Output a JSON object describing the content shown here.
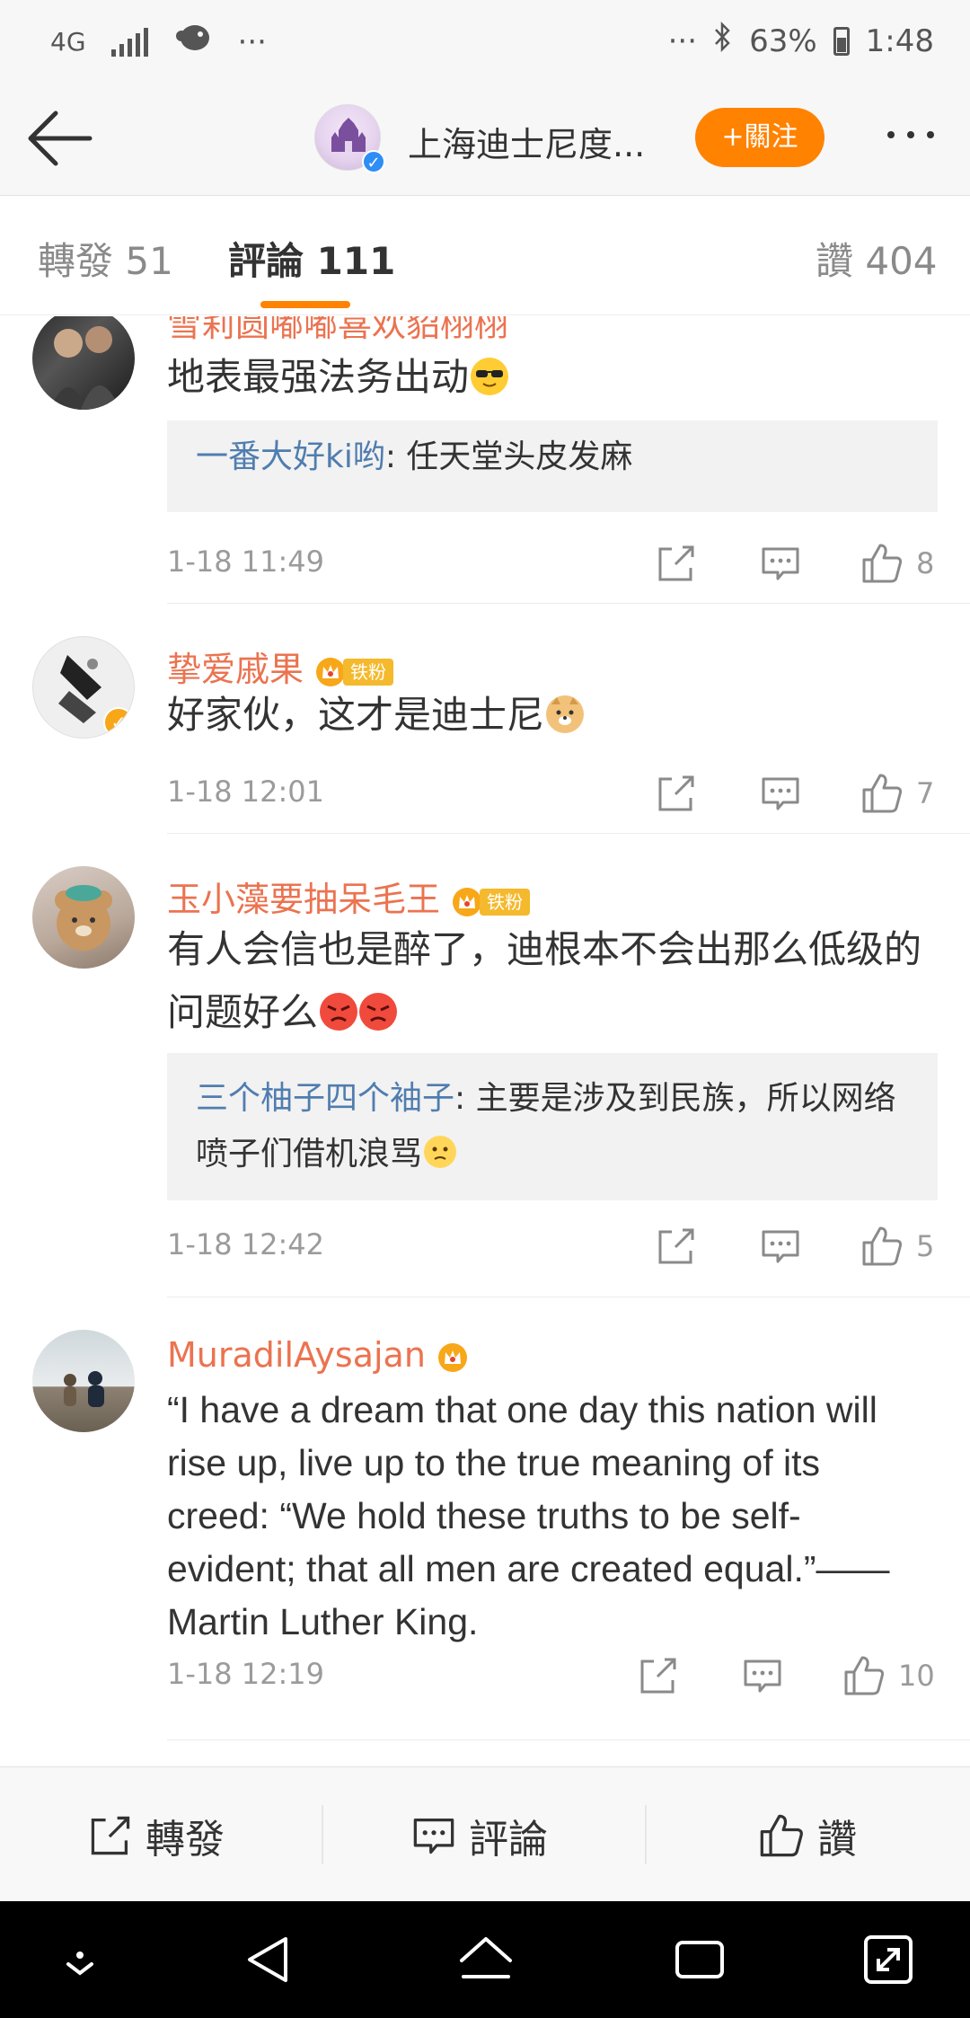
{
  "status_bar": {
    "network": "4G",
    "left_dots": "···",
    "right_dots": "···",
    "battery": "63%",
    "time": "1:48"
  },
  "header": {
    "account_name": "上海迪士尼度...",
    "follow_label": "+關注"
  },
  "tabs": {
    "repost": "轉發 51",
    "comments": "評論 111",
    "likes": "讚 404"
  },
  "comments": [
    {
      "username": "雪莉圆嘟嘟喜欢貂栩栩",
      "text": "地表最强法务出动",
      "emoji": "sunglasses",
      "reply": {
        "user": "一番大好ki哟",
        "text": ": 任天堂头皮发麻"
      },
      "time": "1-18 11:49",
      "likes": "8"
    },
    {
      "username": "挚爱戚果",
      "fan_badge": "铁粉",
      "text": "好家伙，这才是迪士尼",
      "emoji": "doge",
      "time": "1-18 12:01",
      "likes": "7"
    },
    {
      "username": "玉小藻要抽呆毛王",
      "fan_badge": "铁粉",
      "text": "有人会信也是醉了，迪根本不会出那么低级的问题好么",
      "emoji": "angry",
      "reply": {
        "user": "三个柚子四个袖子",
        "text": ": 主要是涉及到民族，所以网络喷子们借机浪骂"
      },
      "time": "1-18 12:42",
      "likes": "5"
    },
    {
      "username": "MuradilAysajan",
      "text": "“I have a dream that one day this nation will rise up, live up to the true meaning of its creed: “We hold these truths to be self-evident; that all men are created equal.”—— Martin Luther King.",
      "time": "1-18 12:19",
      "likes": "10"
    }
  ],
  "bottom_bar": {
    "repost": "轉發",
    "comment": "評論",
    "like": "讚"
  },
  "colors": {
    "accent": "#ff8200",
    "username": "#eb7350",
    "reply_user": "#507daf",
    "verified": "#2f8ef5",
    "fan_badge": "#f5b92d"
  }
}
